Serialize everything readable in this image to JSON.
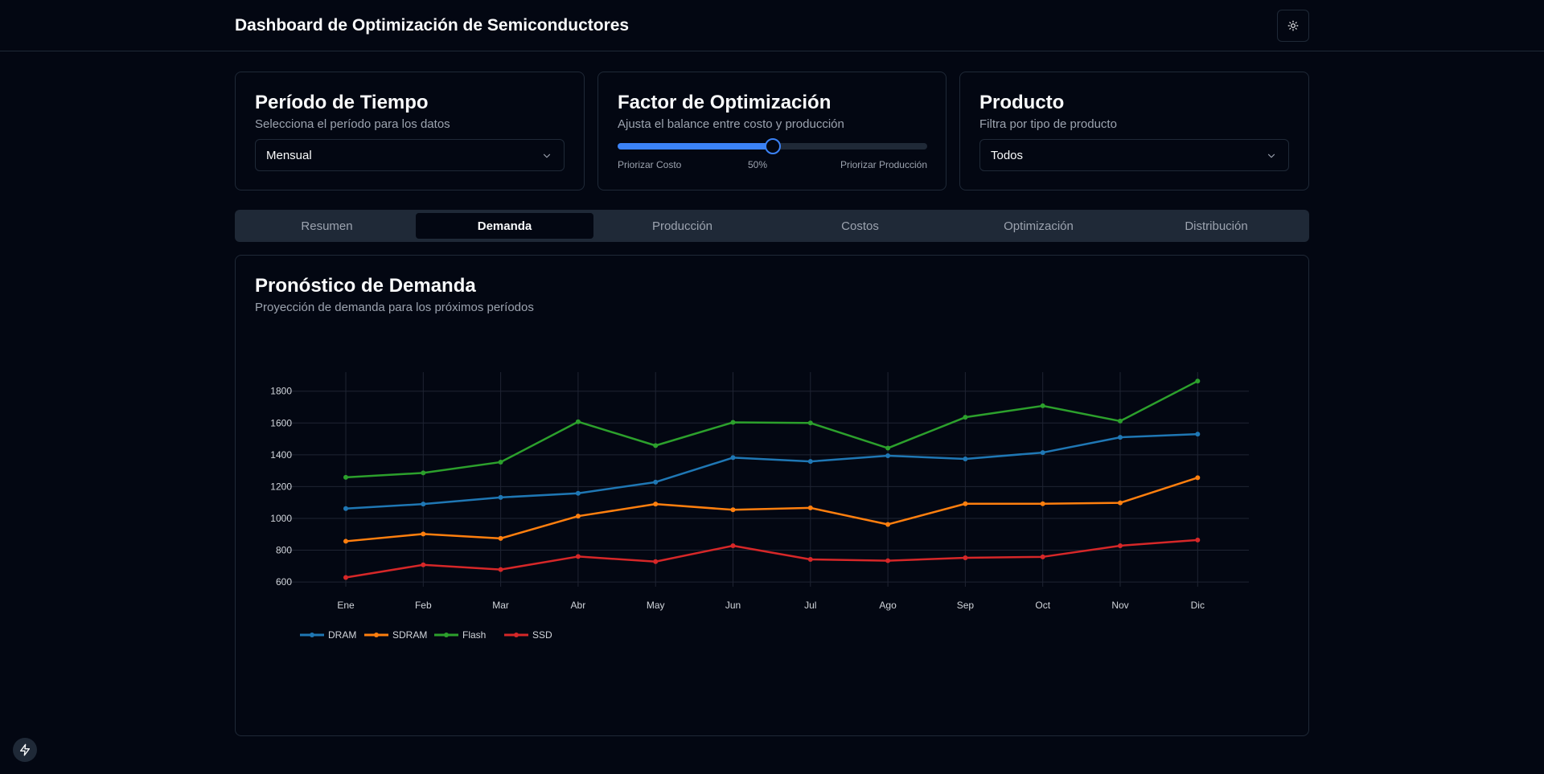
{
  "header": {
    "title": "Dashboard de Optimización de Semiconductores",
    "theme_icon": "sun-icon"
  },
  "filters": {
    "period": {
      "title": "Período de Tiempo",
      "description": "Selecciona el período para los datos",
      "selected": "Mensual"
    },
    "optimization": {
      "title": "Factor de Optimización",
      "description": "Ajusta el balance entre costo y producción",
      "value": 50,
      "value_label": "50%",
      "min_label": "Priorizar Costo",
      "max_label": "Priorizar Producción"
    },
    "product": {
      "title": "Producto",
      "description": "Filtra por tipo de producto",
      "selected": "Todos"
    }
  },
  "tabs": [
    {
      "label": "Resumen",
      "active": false
    },
    {
      "label": "Demanda",
      "active": true
    },
    {
      "label": "Producción",
      "active": false
    },
    {
      "label": "Costos",
      "active": false
    },
    {
      "label": "Optimización",
      "active": false
    },
    {
      "label": "Distribución",
      "active": false
    }
  ],
  "chart_card": {
    "title": "Pronóstico de Demanda",
    "description": "Proyección de demanda para los próximos períodos"
  },
  "chart_data": {
    "type": "line",
    "categories": [
      "Ene",
      "Feb",
      "Mar",
      "Abr",
      "May",
      "Jun",
      "Jul",
      "Ago",
      "Sep",
      "Oct",
      "Nov",
      "Dic"
    ],
    "yticks": [
      600,
      800,
      1000,
      1200,
      1400,
      1600,
      1800
    ],
    "ylim": [
      570,
      1920
    ],
    "grid": true,
    "legend_position": "bottom-left",
    "series": [
      {
        "name": "DRAM",
        "color": "#1f77b4",
        "values": [
          1062,
          1090,
          1132,
          1158,
          1228,
          1382,
          1358,
          1394,
          1374,
          1414,
          1510,
          1530
        ]
      },
      {
        "name": "SDRAM",
        "color": "#ff7f0e",
        "values": [
          856,
          902,
          874,
          1014,
          1090,
          1054,
          1066,
          962,
          1092,
          1092,
          1098,
          1256
        ]
      },
      {
        "name": "Flash",
        "color": "#2ca02c",
        "values": [
          1258,
          1286,
          1354,
          1608,
          1458,
          1604,
          1600,
          1442,
          1636,
          1708,
          1612,
          1864
        ]
      },
      {
        "name": "SSD",
        "color": "#d62728",
        "values": [
          628,
          708,
          678,
          760,
          728,
          828,
          742,
          734,
          752,
          758,
          828,
          864
        ]
      }
    ]
  },
  "fab": {
    "icon": "bolt-icon"
  }
}
